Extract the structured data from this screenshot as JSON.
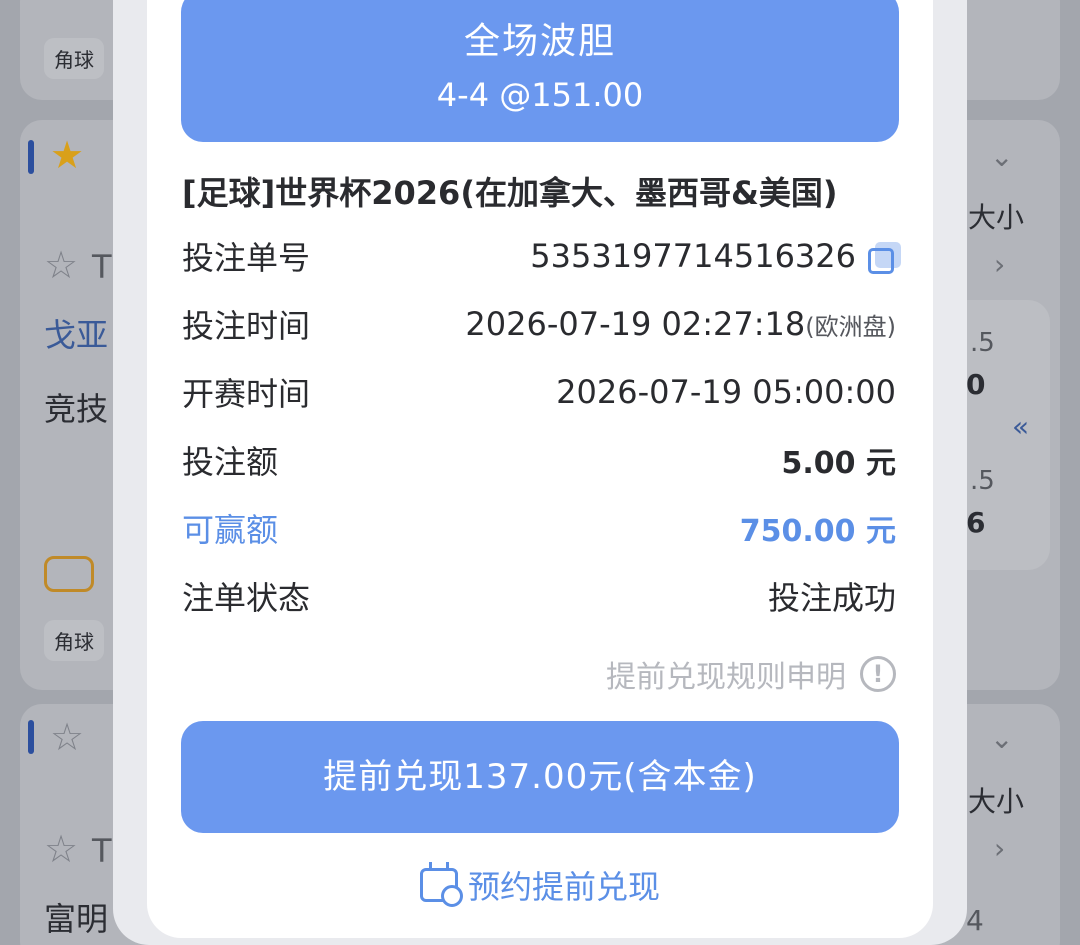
{
  "background": {
    "chip_corner": "角球",
    "chip_corner_2": "角球",
    "team_partial_1": "戈亚",
    "team_partial_2": "竞技",
    "team_partial_3": "富明",
    "side_label_1": "大小",
    "side_label_2": "大小",
    "odds_partial_1": ".5",
    "odds_partial_2": "0",
    "odds_partial_3": ".5",
    "odds_partial_4": "6",
    "odds_partial_5": "4",
    "t_letter_1": "T",
    "t_letter_2": "T"
  },
  "bet": {
    "market": "全场波胆",
    "selection_odds": "4-4 @151.00",
    "league": "[足球]世界杯2026(在加拿大、墨西哥&美国)",
    "rows": {
      "bet_no_label": "投注单号",
      "bet_no_value": "5353197714516326",
      "bet_time_label": "投注时间",
      "bet_time_value": "2026-07-19 02:27:18",
      "odds_format": "(欧洲盘)",
      "start_time_label": "开赛时间",
      "start_time_value": "2026-07-19 05:00:00",
      "stake_label": "投注额",
      "stake_value": "5.00 元",
      "win_label": "可赢额",
      "win_value": "750.00 元",
      "status_label": "注单状态",
      "status_value": "投注成功"
    },
    "rules_link": "提前兑现规则申明",
    "cashout_button": "提前兑现137.00元(含本金)",
    "reserve_link": "预约提前兑现"
  },
  "colors": {
    "accent": "#6b98ef",
    "link_blue": "#5b8fe6",
    "muted": "#b6b8be"
  }
}
